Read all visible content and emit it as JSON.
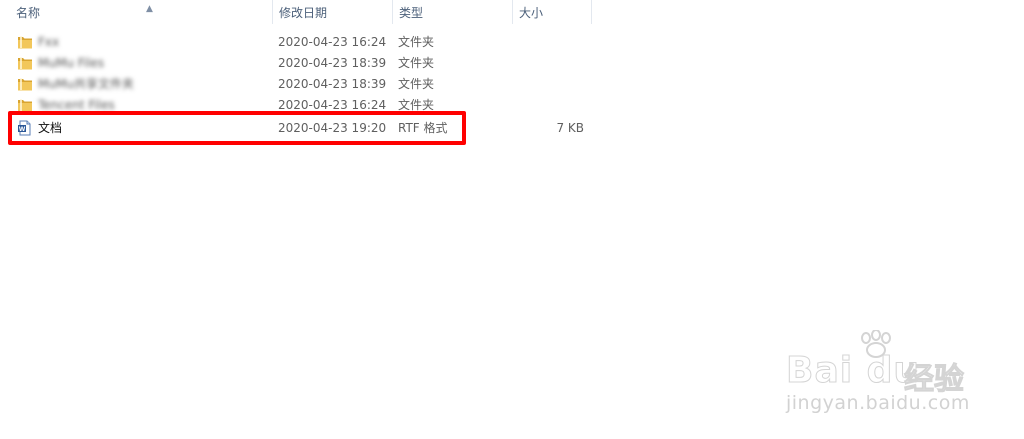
{
  "columns": {
    "name": "名称",
    "date": "修改日期",
    "type": "类型",
    "size": "大小"
  },
  "files": [
    {
      "name": "Fxx",
      "date": "2020-04-23 16:24",
      "type": "文件夹",
      "size": "",
      "kind": "folder",
      "blurred": true
    },
    {
      "name": "MuMu Files",
      "date": "2020-04-23 18:39",
      "type": "文件夹",
      "size": "",
      "kind": "folder",
      "blurred": true
    },
    {
      "name": "MuMu共享文件夹",
      "date": "2020-04-23 18:39",
      "type": "文件夹",
      "size": "",
      "kind": "folder",
      "blurred": true
    },
    {
      "name": "Tencent Files",
      "date": "2020-04-23 16:24",
      "type": "文件夹",
      "size": "",
      "kind": "folder",
      "blurred": true
    },
    {
      "name": "文档",
      "date": "2020-04-23 19:20",
      "type": "RTF 格式",
      "size": "7 KB",
      "kind": "document",
      "blurred": false
    }
  ],
  "watermark": {
    "logo": "Bai du",
    "cn": "经验",
    "url": "jingyan.baidu.com"
  },
  "colors": {
    "folder": "#e8b84a",
    "highlight": "#ff0000",
    "header_text": "#4c607a"
  }
}
